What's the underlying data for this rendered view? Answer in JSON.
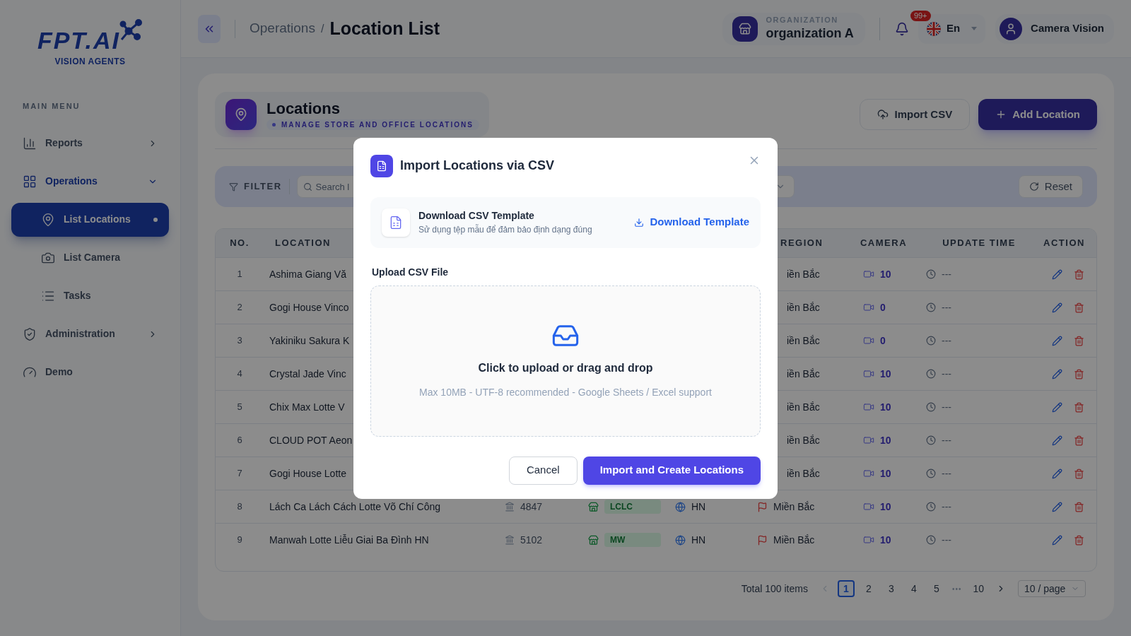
{
  "sidebar": {
    "logo": {
      "name": "FPT.AI",
      "tagline": "VISION AGENTS"
    },
    "section": "MAIN MENU",
    "items": [
      {
        "label": "Reports",
        "kind": "group",
        "expanded": false,
        "selected": false
      },
      {
        "label": "Operations",
        "kind": "group",
        "expanded": true,
        "selected": true,
        "children": [
          {
            "label": "List Locations",
            "selected": true
          },
          {
            "label": "List Camera",
            "selected": false
          },
          {
            "label": "Tasks",
            "selected": false
          }
        ]
      },
      {
        "label": "Administration",
        "kind": "group",
        "expanded": false,
        "selected": false
      },
      {
        "label": "Demo",
        "kind": "link",
        "selected": false
      }
    ]
  },
  "header": {
    "breadcrumb": [
      "Operations",
      "Location List"
    ],
    "breadcrumb_separator": "/",
    "organization": {
      "label": "ORGANIZATION",
      "name": "organization A"
    },
    "notifications": {
      "badge": "99+"
    },
    "language": "En",
    "user": "Camera Vision"
  },
  "page": {
    "title": "Locations",
    "subtitle": "MANAGE STORE AND OFFICE LOCATIONS",
    "buttons": [
      {
        "label": "Import CSV",
        "kind": "secondary"
      },
      {
        "label": "Add Location",
        "kind": "primary"
      }
    ],
    "filter": {
      "label": "FILTER",
      "search_placeholder": "Search l",
      "reset": "Reset"
    },
    "table": {
      "columns": [
        "NO.",
        "LOCATION",
        "REGION",
        "CAMERA",
        "UPDATE TIME",
        "ACTION"
      ],
      "rows": [
        {
          "no": "1",
          "location": "Ashima Giang Vă",
          "region": "iền Bắc",
          "camera": "10",
          "update_time": "---"
        },
        {
          "no": "2",
          "location": "Gogi House Vinco",
          "region": "iền Bắc",
          "camera": "0",
          "update_time": "---"
        },
        {
          "no": "3",
          "location": "Yakiniku Sakura K",
          "region": "iền Bắc",
          "camera": "0",
          "update_time": "---"
        },
        {
          "no": "4",
          "location": "Crystal Jade Vinc",
          "region": "iền Bắc",
          "camera": "10",
          "update_time": "---"
        },
        {
          "no": "5",
          "location": "Chix Max Lotte V",
          "region": "iền Bắc",
          "camera": "10",
          "update_time": "---"
        },
        {
          "no": "6",
          "location": "CLOUD POT Aeon",
          "region": "iền Bắc",
          "camera": "10",
          "update_time": "---"
        },
        {
          "no": "7",
          "location": "Gogi House Lotte",
          "region": "iền Bắc",
          "camera": "10",
          "update_time": "---"
        },
        {
          "no": "8",
          "location": "Lách Ca Lách Cách Lotte Võ Chí Công",
          "code": "4847",
          "store": "LCLC",
          "city": "HN",
          "region": "Miền Bắc",
          "camera": "10",
          "update_time": "---"
        },
        {
          "no": "9",
          "location": "Manwah Lotte Liễu Giai Ba Đình HN",
          "code": "5102",
          "store": "MW",
          "city": "HN",
          "region": "Miền Bắc",
          "camera": "10",
          "update_time": "---"
        }
      ]
    },
    "pagination": {
      "total": "Total 100 items",
      "pages": [
        {
          "label": "1",
          "kind": "page",
          "selected": true
        },
        {
          "label": "2",
          "kind": "page",
          "selected": false
        },
        {
          "label": "3",
          "kind": "page",
          "selected": false
        },
        {
          "label": "4",
          "kind": "page",
          "selected": false
        },
        {
          "label": "5",
          "kind": "page",
          "selected": false
        },
        {
          "label": "•••",
          "kind": "ellipsis",
          "selected": false
        },
        {
          "label": "10",
          "kind": "page",
          "selected": false
        }
      ],
      "page_size": "10 / page"
    }
  },
  "modal": {
    "title": "Import Locations via CSV",
    "template": {
      "title": "Download CSV Template",
      "description": "Sử dụng tệp mẫu để đảm bảo định dạng đúng",
      "action": "Download Template"
    },
    "upload": {
      "label": "Upload CSV File",
      "prompt": "Click to upload or drag and drop",
      "hint": "Max 10MB - UTF-8 recommended - Google Sheets / Excel support"
    },
    "buttons": [
      {
        "label": "Cancel",
        "kind": "secondary"
      },
      {
        "label": "Import and Create Locations",
        "kind": "primary"
      }
    ]
  }
}
